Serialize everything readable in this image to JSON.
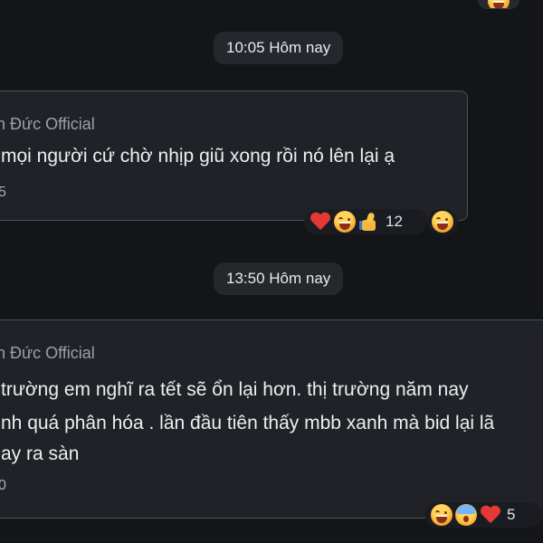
{
  "top": {
    "reaction": "laugh-emoji-icon"
  },
  "dividers": [
    {
      "label": "10:05 Hôm nay"
    },
    {
      "label": "13:50 Hôm nay"
    }
  ],
  "messages": [
    {
      "sender": "ăn Đức Official",
      "lines": [
        "mọi người cứ chờ nhịp giũ xong rồi nó lên lại ạ"
      ],
      "time": "5",
      "reactions": {
        "main": [
          "heart-emoji-icon",
          "laugh-emoji-icon",
          "thumbs-up-emoji-icon"
        ],
        "count": "12",
        "separate": "laugh-emoji-icon"
      }
    },
    {
      "sender": "ăn Đức Official",
      "lines": [
        "trường em nghĩ ra tết sẽ ổn lại hơn. thị trường năm nay",
        "nh quá phân hóa . lần đầu tiên thấy mbb xanh mà bid lại lã",
        "ay ra sàn"
      ],
      "time": "0",
      "reactions": {
        "main": [
          "laugh-emoji-icon",
          "fear-emoji-icon",
          "heart-emoji-icon"
        ],
        "count": "5"
      }
    }
  ]
}
